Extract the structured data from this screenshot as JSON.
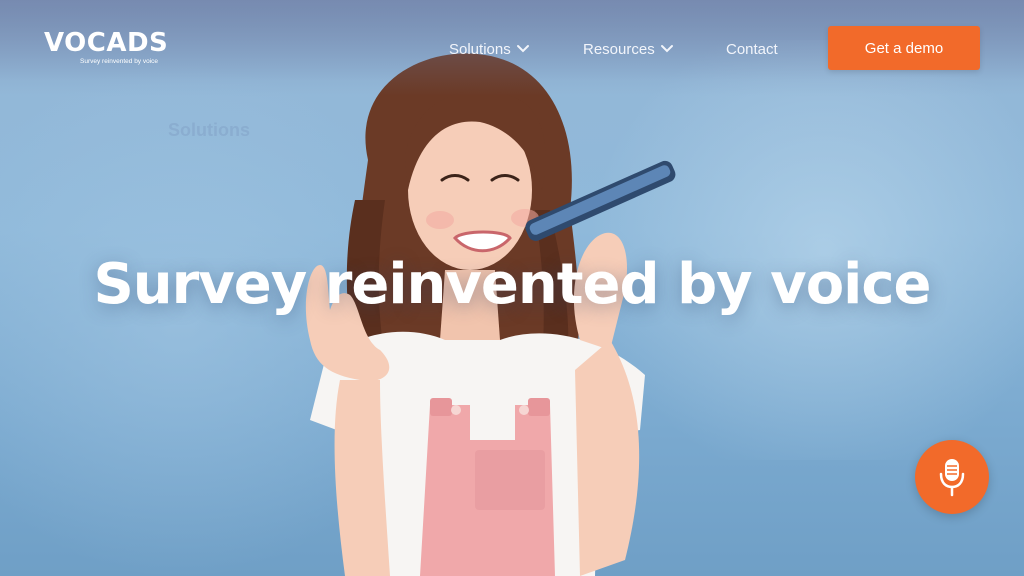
{
  "brand": {
    "name": "VOCADS",
    "tagline": "Survey reinvented by voice"
  },
  "nav": {
    "items": [
      {
        "label": "Solutions",
        "has_dropdown": true
      },
      {
        "label": "Resources",
        "has_dropdown": true
      },
      {
        "label": "Contact",
        "has_dropdown": false
      }
    ],
    "cta_label": "Get a demo"
  },
  "hero": {
    "title": "Survey reinvented by voice"
  },
  "background_ghost": {
    "solutions_label": "Solutions"
  },
  "icons": {
    "dropdown": "chevron-down-icon",
    "voice_button": "microphone-icon"
  },
  "colors": {
    "accent": "#f26a2a",
    "background": "#8fb9da",
    "text_light": "#ffffff"
  }
}
